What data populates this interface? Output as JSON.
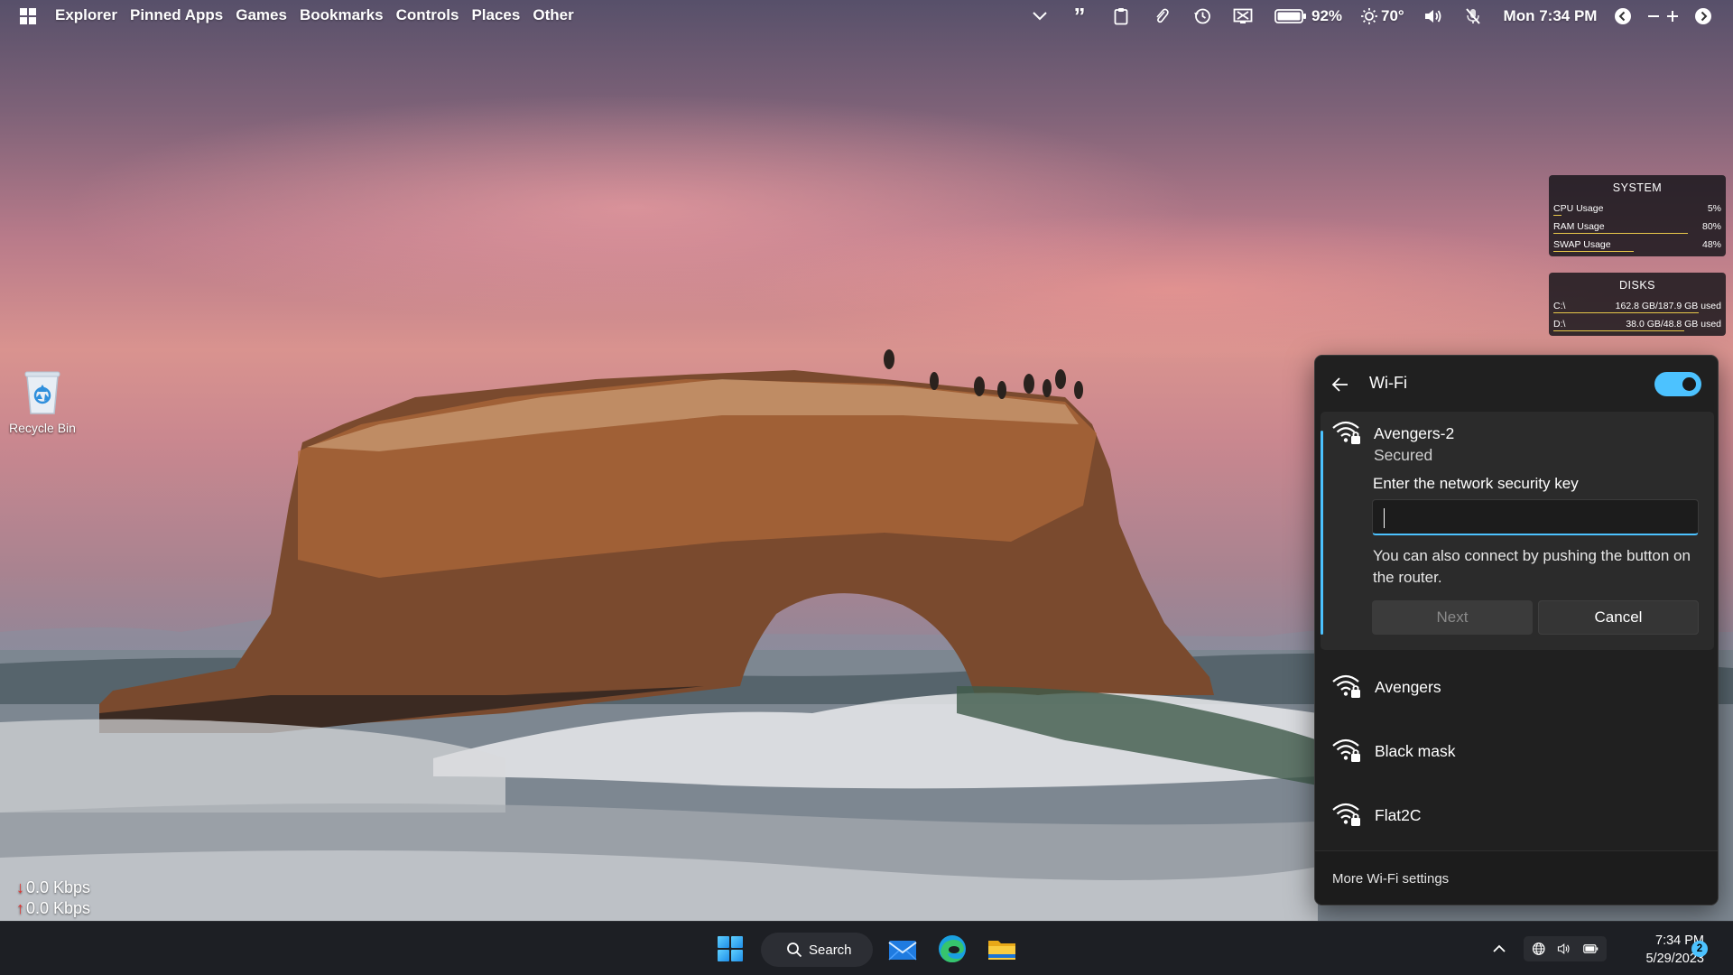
{
  "topbar": {
    "menus": [
      "Explorer",
      "Pinned Apps",
      "Games",
      "Bookmarks",
      "Controls",
      "Places",
      "Other"
    ],
    "battery": "92%",
    "weather": "70°",
    "datetime": "Mon 7:34 PM",
    "icons": [
      "windows-logo-icon",
      "chevron-down-icon",
      "quote-icon",
      "clipboard-icon",
      "paperclip-icon",
      "history-icon",
      "screen-off-icon",
      "battery-icon",
      "sun-icon",
      "volume-icon",
      "mic-muted-icon",
      "chevron-left-circle-icon",
      "minus-icon",
      "plus-icon",
      "chevron-right-circle-icon"
    ]
  },
  "desktop": {
    "recycle_bin_label": "Recycle Bin"
  },
  "system_widget": {
    "title": "SYSTEM",
    "rows": [
      {
        "label": "CPU Usage",
        "value": "5%",
        "level": 0.05
      },
      {
        "label": "RAM Usage",
        "value": "80%",
        "level": 0.8
      },
      {
        "label": "SWAP Usage",
        "value": "48%",
        "level": 0.48
      }
    ]
  },
  "disks_widget": {
    "title": "DISKS",
    "rows": [
      {
        "label": "C:\\",
        "value": "162.8 GB/187.9 GB used",
        "level": 0.866
      },
      {
        "label": "D:\\",
        "value": "38.0 GB/48.8 GB used",
        "level": 0.779
      }
    ]
  },
  "netspeed": {
    "down": "0.0 Kbps",
    "up": "0.0 Kbps"
  },
  "wifi_panel": {
    "title": "Wi-Fi",
    "toggle_on": true,
    "accent_color": "#4cc2ff",
    "selected_network": {
      "name": "Avengers-2",
      "status": "Secured",
      "key_label": "Enter the network security key",
      "key_value": "",
      "hint": "You can also connect by pushing the button on the router.",
      "next_label": "Next",
      "cancel_label": "Cancel"
    },
    "networks": [
      "Avengers",
      "Black mask",
      "Flat2C"
    ],
    "footer_link": "More Wi-Fi settings"
  },
  "taskbar": {
    "search_label": "Search",
    "apps": [
      "mail-icon",
      "edge-icon",
      "file-explorer-icon"
    ],
    "time": "7:34 PM",
    "date": "5/29/2023",
    "notification_count": "2"
  }
}
